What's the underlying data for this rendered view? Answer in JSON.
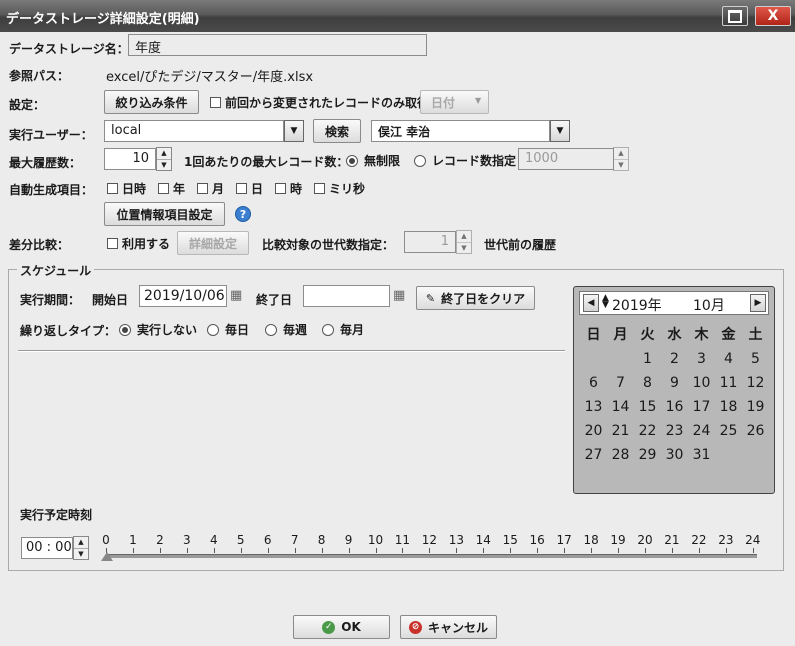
{
  "window": {
    "title": "データストレージ詳細設定(明細)",
    "close_label": "X"
  },
  "storage_name": {
    "label": "データストレージ名：",
    "value": "年度"
  },
  "reference_path": {
    "label": "参照パス：",
    "value": "excel/ぴたデジ/マスター/年度.xlsx"
  },
  "settings": {
    "label": "設定：",
    "filter_button": "絞り込み条件",
    "changed_only_label": "前回から変更されたレコードのみ取得",
    "date_select": "日付"
  },
  "exec_user": {
    "label": "実行ユーザー：",
    "value": "local",
    "search_button": "検索",
    "user_name": "俣江 幸治"
  },
  "history": {
    "label": "最大履歴数：",
    "value": "10",
    "max_records_label": "1回あたりの最大レコード数：",
    "unlimited_label": "無制限",
    "specify_label": "レコード数指定",
    "record_count": "1000",
    "selected": "unlimited"
  },
  "auto_items": {
    "label": "自動生成項目：",
    "items": [
      "日時",
      "年",
      "月",
      "日",
      "時",
      "ミリ秒"
    ]
  },
  "location_button": "位置情報項目設定",
  "diff": {
    "label": "差分比較：",
    "use_label": "利用する",
    "detail_button": "詳細設定",
    "generations_label": "比較対象の世代数指定：",
    "generations_value": "1",
    "suffix": "世代前の履歴"
  },
  "schedule": {
    "legend": "スケジュール",
    "period_label": "実行期間：",
    "start_label": "開始日",
    "start_value": "2019/10/06",
    "end_label": "終了日",
    "end_value": "",
    "clear_button": "終了日をクリア",
    "repeat_label": "繰り返しタイプ：",
    "repeat_options": [
      "実行しない",
      "毎日",
      "毎週",
      "毎月"
    ],
    "repeat_selected": 0,
    "time_label": "実行予定時刻",
    "time_value": "00 : 00"
  },
  "calendar": {
    "year": "2019年",
    "month": "10月",
    "weekdays": [
      "日",
      "月",
      "火",
      "水",
      "木",
      "金",
      "土"
    ],
    "first_weekday": 2,
    "days": 31
  },
  "hours": [
    "0",
    "1",
    "2",
    "3",
    "4",
    "5",
    "6",
    "7",
    "8",
    "9",
    "10",
    "11",
    "12",
    "13",
    "14",
    "15",
    "16",
    "17",
    "18",
    "19",
    "20",
    "21",
    "22",
    "23",
    "24"
  ],
  "footer": {
    "ok": "OK",
    "cancel": "キャンセル"
  }
}
